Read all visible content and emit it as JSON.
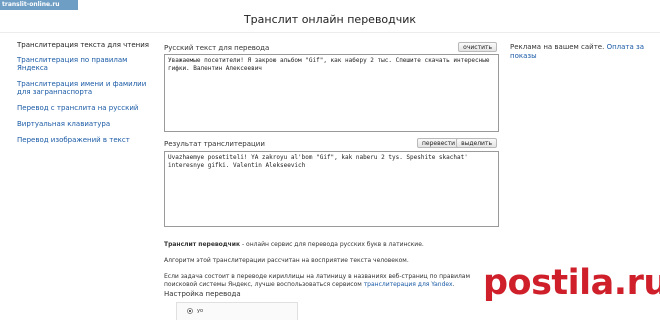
{
  "logo": "translit-online.ru",
  "page_title": "Транслит онлайн переводчик",
  "sidebar": {
    "heading": "Транслитерация текста для чтения",
    "items": [
      "Транслитерация по правилам Яндекса",
      "Транслитерация имени и фамилии для загранпаспорта",
      "Перевод с транслита на русский",
      "Виртуальная клавиатура",
      "Перевод изображений в текст"
    ]
  },
  "input": {
    "label": "Русский текст для перевода",
    "clear_label": "очистить",
    "text": "Уважаемые посетители! Я закрою альбом \"Gif\", как наберу 2 тыс. Спешите скачать интересные гифки. Валентин Алексеевич"
  },
  "output": {
    "label": "Результат транслитерации",
    "translate_label": "перевести",
    "select_label": "выделить",
    "text": "Uvazhaemye posetiteli! YA zakroyu al'bom \"Gif\", kak naberu 2 tys. Speshite skachat' interesnye gifki. Valentin Alekseevich"
  },
  "info": {
    "p1_bold": "Транслит переводчик",
    "p1_rest": " - онлайн сервис для перевода русских букв в латинские.",
    "p2": "Алгоритм этой транслитерации рассчитан на восприятие текста человеком.",
    "p3_pre": "Если задача состоит в переводе кириллицы на латиницу в названиях веб-страниц по правилам поисковой системы Яндекс, лучше воспользоваться сервисом ",
    "p3_link": "транслитерация для Yandex",
    "p3_post": "."
  },
  "settings": {
    "title": "Настройка перевода",
    "option": "yo"
  },
  "ads": {
    "text": "Реклама на вашем сайте. ",
    "link": "Оплата за показы"
  },
  "watermark": "postila.ru"
}
